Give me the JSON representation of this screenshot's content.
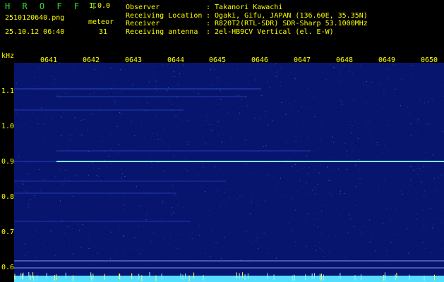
{
  "header": {
    "app_name": "H R O F F T",
    "version": "1.0.0",
    "filename": "2510120640.png",
    "meteor_label": "meteor",
    "datetime": "25.10.12 06:40",
    "meteor_count": "31",
    "info_rows": [
      {
        "label": "Observer",
        "value": ": Takanori Kawachi"
      },
      {
        "label": "Receiving Location",
        "value": ": Ogaki, Gifu, JAPAN (136.60E, 35.35N)"
      },
      {
        "label": "Receiver",
        "value": ": R820T2(RTL-SDR) SDR-Sharp 53.1000MHz"
      },
      {
        "label": "Receiving antenna",
        "value": ": 2el-HB9CV Vertical (el. E-W)"
      }
    ]
  },
  "axis": {
    "y_unit": "kHz",
    "y_ticks": [
      "1.1",
      "1.0",
      "0.9",
      "0.8",
      "0.7",
      "0.6"
    ],
    "x_ticks": [
      "0641",
      "0642",
      "0643",
      "0644",
      "0645",
      "0646",
      "0647",
      "0648",
      "0649",
      "0650"
    ]
  },
  "colors": {
    "text": "#ffff00",
    "title": "#33dd33",
    "background": "#08156f",
    "signal": "#7fe6ff",
    "baseline": "#55ddff"
  }
}
